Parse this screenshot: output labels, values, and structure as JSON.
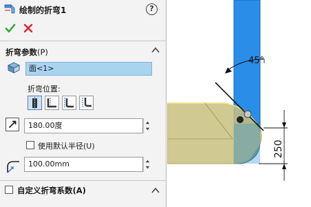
{
  "title": "绘制的折弯1",
  "help_glyph": "?",
  "section": {
    "title": "折弯参数",
    "suffix": "(P)"
  },
  "face_field": {
    "value": "面<1>"
  },
  "bend_position": {
    "label": "折弯位置:",
    "options": [
      "bend-centerline",
      "material-inside",
      "material-outside",
      "bend-outside"
    ],
    "selected": 0
  },
  "angle_field": {
    "value": "180.00度"
  },
  "use_default_radius": {
    "label": "使用默认半径(U)",
    "checked": false
  },
  "radius_field": {
    "value": "100.00mm"
  },
  "custom_bend": {
    "label": "自定义折弯系数(A)",
    "checked": false
  },
  "graphics": {
    "angle_label": "45°",
    "dimension_label": "250"
  },
  "colors": {
    "accent_blue": "#2a8ee8",
    "field_highlight": "#a8d4f0",
    "ok_green": "#3aa63a",
    "cancel_red": "#d32626",
    "part_olive": "#c8c080"
  }
}
